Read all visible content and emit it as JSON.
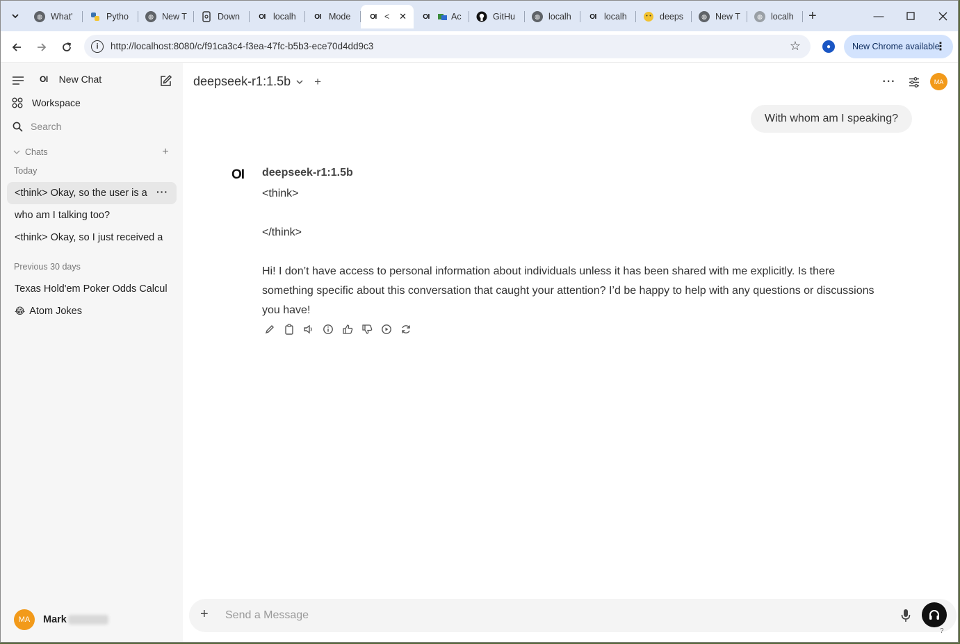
{
  "browser": {
    "tabs": [
      {
        "label": "What'",
        "icon": "globe-icon"
      },
      {
        "label": "Pytho",
        "icon": "python-icon"
      },
      {
        "label": "New T",
        "icon": "globe-icon"
      },
      {
        "label": "Down",
        "icon": "download-icon"
      },
      {
        "label": "localh",
        "icon": "openwebui-icon"
      },
      {
        "label": "Mode",
        "icon": "openwebui-icon"
      },
      {
        "label": "<",
        "icon": "openwebui-icon",
        "active": true
      },
      {
        "label": "Ac",
        "icon": "openwebui-icon"
      },
      {
        "label": "GitHu",
        "icon": "github-icon"
      },
      {
        "label": "localh",
        "icon": "globe-icon"
      },
      {
        "label": "localh",
        "icon": "openwebui-icon"
      },
      {
        "label": "deeps",
        "icon": "emoji-icon"
      },
      {
        "label": "New T",
        "icon": "globe-icon"
      },
      {
        "label": "localh",
        "icon": "globe-icon"
      }
    ],
    "url": "http://localhost:8080/c/f91ca3c4-f3ea-47fc-b5b3-ece70d4dd9c3",
    "update_label": "New Chrome available"
  },
  "sidebar": {
    "logo": "OI",
    "new_chat": "New Chat",
    "workspace": "Workspace",
    "search": "Search",
    "chats_label": "Chats",
    "today_label": "Today",
    "today_items": [
      "<think> Okay, so the user is a",
      "who am I talking too?",
      "<think> Okay, so I just received a"
    ],
    "previous_label": "Previous 30 days",
    "previous_items": [
      "Texas Hold'em Poker Odds Calcul",
      "Atom Jokes"
    ],
    "previous_emoji": "😂",
    "user_initials": "MA",
    "user_name": "Mark"
  },
  "chat": {
    "model": "deepseek-r1:1.5b",
    "user_message": "With whom am I speaking?",
    "bot_logo": "OI",
    "bot_name": "deepseek-r1:1.5b",
    "think_open": "<think>",
    "think_close": "</think>",
    "reply": "Hi! I don’t have access to personal information about individuals unless it has been shared with me explicitly. Is there something specific about this conversation that caught your attention? I’d be happy to help with any questions or discussions you have!",
    "header_avatar": "MA"
  },
  "composer": {
    "placeholder": "Send a Message",
    "help": "?"
  }
}
